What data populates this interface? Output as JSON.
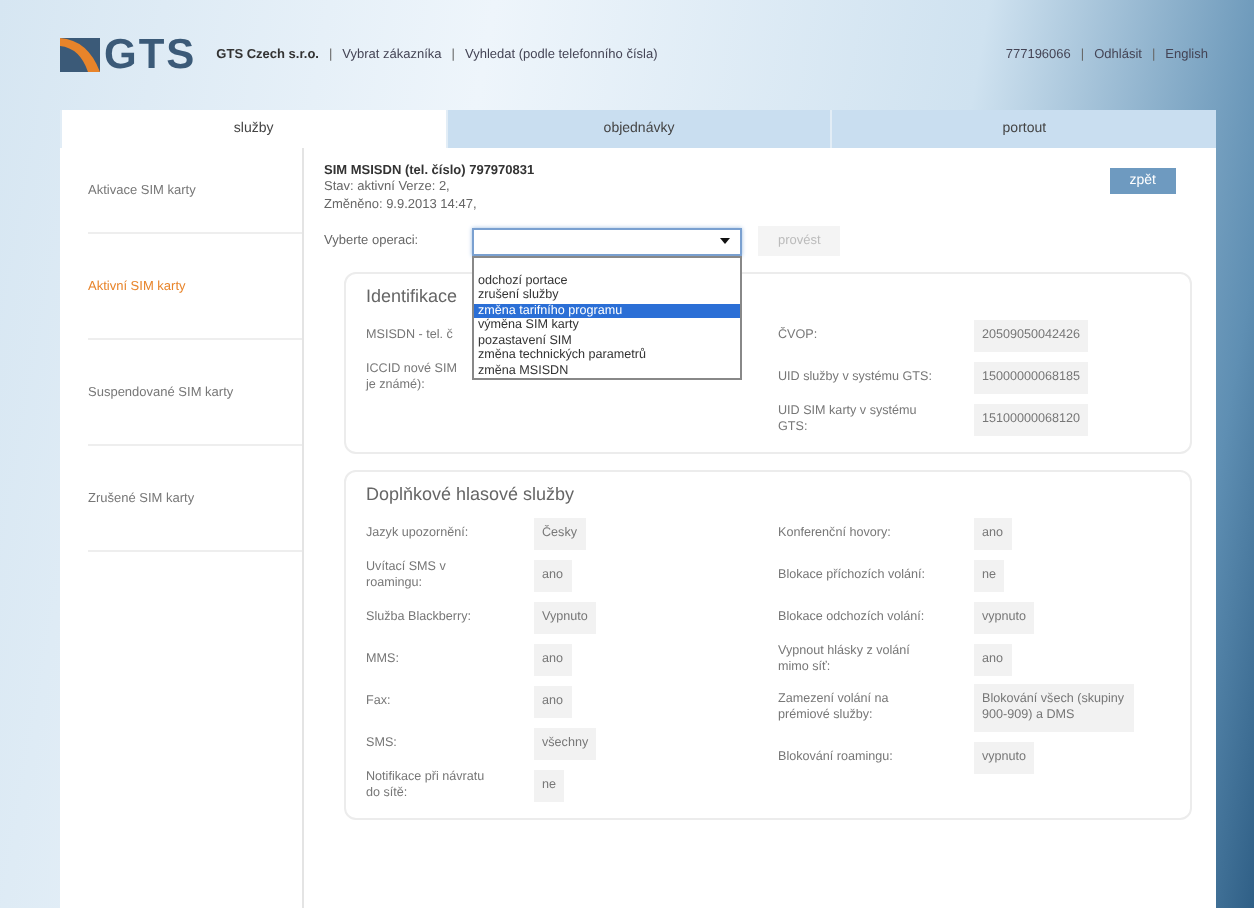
{
  "header": {
    "logo": "GTS",
    "left": [
      {
        "kind": "company",
        "text": "GTS Czech s.r.o."
      },
      {
        "kind": "separator",
        "text": "|"
      },
      {
        "kind": "link",
        "text": "Vybrat zákazníka"
      },
      {
        "kind": "separator",
        "text": "|"
      },
      {
        "kind": "link",
        "text": "Vyhledat (podle telefonního čísla)"
      }
    ],
    "right": [
      {
        "kind": "link",
        "text": "777196066"
      },
      {
        "kind": "separator",
        "text": "|"
      },
      {
        "kind": "link",
        "text": "Odhlásit"
      },
      {
        "kind": "separator",
        "text": "|"
      },
      {
        "kind": "link",
        "text": "English"
      }
    ]
  },
  "tabs": [
    {
      "label": "služby",
      "selected": true
    },
    {
      "label": "objednávky",
      "selected": false
    },
    {
      "label": "portout",
      "selected": false
    }
  ],
  "sidebar": {
    "items": [
      {
        "label": "Aktivace SIM karty",
        "selected": false
      },
      {
        "label": "Aktivní SIM karty",
        "selected": true
      },
      {
        "label": "Suspendované SIM karty",
        "selected": false
      },
      {
        "label": "Zrušené SIM karty",
        "selected": false
      }
    ]
  },
  "sim": {
    "title": "SIM MSISDN (tel. číslo) 797970831",
    "status": "Stav: aktivní   Verze: 2,",
    "changed": "Změněno: 9.9.2013 14:47,"
  },
  "back_button": "zpět",
  "operation": {
    "label": "Vyberte operaci:",
    "expanded": true,
    "options": [
      {
        "label": "odchozí portace",
        "selected": false
      },
      {
        "label": "zrušení služby",
        "selected": false
      },
      {
        "label": "změna tarifního programu",
        "selected": true
      },
      {
        "label": "výměna SIM karty",
        "selected": false
      },
      {
        "label": "pozastavení SIM",
        "selected": false
      },
      {
        "label": "změna technických parametrů",
        "selected": false
      },
      {
        "label": "změna MSISDN",
        "selected": false
      }
    ],
    "submit": {
      "label": "provést",
      "disabled": true
    }
  },
  "sections": [
    {
      "title": "Identifikace",
      "left": [
        {
          "label": "MSISDN - tel. č"
        },
        {
          "label": "ICCID nové SIM je známé):"
        }
      ],
      "right": [
        {
          "label": "ČVOP:",
          "value": "20509050042426"
        },
        {
          "label": "UID služby v systému GTS:",
          "value": "15000000068185"
        },
        {
          "label": "UID SIM karty v systému GTS:",
          "value": "15100000068120"
        }
      ]
    },
    {
      "title": "Doplňkové hlasové služby",
      "left": [
        {
          "label": "Jazyk upozornění:",
          "value": "Česky"
        },
        {
          "label": "Uvítací SMS v roamingu:",
          "value": "ano"
        },
        {
          "label": "Služba Blackberry:",
          "value": "Vypnuto"
        },
        {
          "label": "MMS:",
          "value": "ano"
        },
        {
          "label": "Fax:",
          "value": "ano"
        },
        {
          "label": "SMS:",
          "value": "všechny"
        },
        {
          "label": "Notifikace při návratu do sítě:",
          "value": "ne"
        }
      ],
      "right": [
        {
          "label": "Konferenční hovory:",
          "value": "ano"
        },
        {
          "label": "Blokace příchozích volání:",
          "value": "ne"
        },
        {
          "label": "Blokace odchozích volání:",
          "value": "vypnuto"
        },
        {
          "label": "Vypnout hlásky z volání mimo síť:",
          "value": "ano"
        },
        {
          "label": "Zamezení volání na prémiové služby:",
          "value": "Blokování všech (skupiny 900-909) a DMS"
        },
        {
          "label": "Blokování roamingu:",
          "value": "vypnuto"
        }
      ]
    }
  ]
}
